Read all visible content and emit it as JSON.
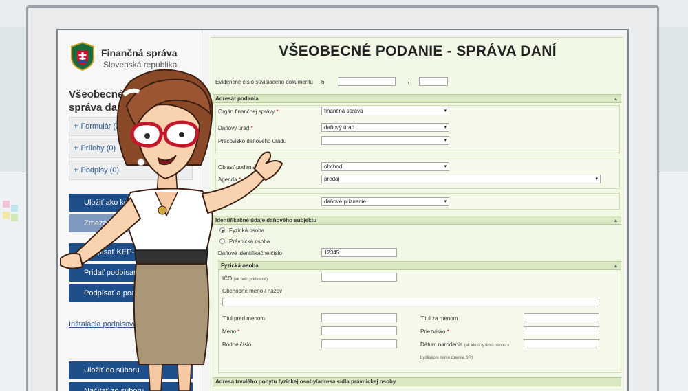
{
  "sidebar": {
    "org_name": "Finančná správa",
    "org_sub": "Slovenská republika",
    "title": "Všeobecné podanie - správa daní",
    "sections": [
      {
        "label": "Formulár (Živé)"
      },
      {
        "label": "Prílohy (0)"
      },
      {
        "label": "Podpisy (0)"
      }
    ],
    "buttons": [
      {
        "label": "Uložiť ako koncept"
      },
      {
        "label": "Zmazať koncept"
      },
      {
        "label": "Podpísať KEP-om"
      },
      {
        "label": "Pridať podpísané prílohy"
      },
      {
        "label": "Podpísať a podať"
      }
    ],
    "install_link": "Inštalácia podpisovej komponenty",
    "buttons_bottom": [
      {
        "label": "Uložiť do súboru"
      },
      {
        "label": "Načítať zo súboru"
      }
    ]
  },
  "form": {
    "title": "VŠEOBECNÉ PODANIE - SPRÁVA DANÍ",
    "evidence_label": "Evidenčné číslo súvisiaceho dokumentu",
    "evidence_prefix": "6",
    "evidence_separator": "/",
    "sec_adresat": "Adresát podania",
    "organ_label": "Orgán finančnej správy",
    "organ_value": "finančná správa",
    "urad_label": "Daňový úrad",
    "urad_value": "daňový úrad",
    "pracovisko_label": "Pracovisko daňového úradu",
    "pracovisko_value": "",
    "oblast_label": "Oblasť podania",
    "oblast_value": "obchod",
    "agenda_label": "Agenda",
    "agenda_value": "predaj",
    "typ_value": "daňové priznanie",
    "sec_identifikacne": "Identifikačné údaje daňového subjektu",
    "radio_fyzicka": "Fyzická osoba",
    "radio_pravnicka": "Právnická osoba",
    "dic_label": "Daňové identifikačné číslo",
    "dic_value": "12345",
    "sec_fyzicka": "Fyzická osoba",
    "ico_label": "IČO",
    "ico_note": "(ak bolo pridelené)",
    "obchodne_label": "Obchodné meno / názov",
    "titul_pred_label": "Titul pred menom",
    "titul_za_label": "Titul za menom",
    "meno_label": "Meno",
    "priezvisko_label": "Priezvisko",
    "rodne_label": "Rodné číslo",
    "datum_label": "Dátum narodenia",
    "datum_note": "(ak ide o fyzickú osobu s",
    "datum_note2": "bydliskom mimo územia SR)",
    "sec_adresa": "Adresa trvalého pobytu fyzickej osoby/adresa sídla právnickej osoby"
  },
  "icons": {
    "select_arrow": "▾",
    "collapse": "▴",
    "plus": "+"
  },
  "colors": {
    "form_bg": "#f2f8e6",
    "section_header": "#dbe8c4",
    "sidebar_button": "#1f4f8b",
    "required": "#cc0000"
  }
}
